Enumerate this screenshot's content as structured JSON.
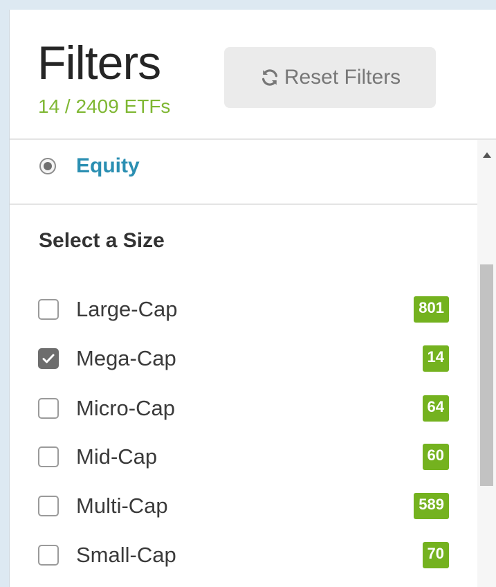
{
  "header": {
    "title": "Filters",
    "count_text": "14 / 2409 ETFs",
    "reset_label": "Reset Filters",
    "reset_icon": "refresh-icon"
  },
  "asset_type": {
    "label": "Equity",
    "selected": true
  },
  "size_filter": {
    "heading": "Select a Size",
    "items": [
      {
        "label": "Large-Cap",
        "count": "801",
        "checked": false
      },
      {
        "label": "Mega-Cap",
        "count": "14",
        "checked": true
      },
      {
        "label": "Micro-Cap",
        "count": "64",
        "checked": false
      },
      {
        "label": "Mid-Cap",
        "count": "60",
        "checked": false
      },
      {
        "label": "Multi-Cap",
        "count": "589",
        "checked": false
      },
      {
        "label": "Small-Cap",
        "count": "70",
        "checked": false
      }
    ]
  },
  "colors": {
    "accent_green": "#74b21f",
    "count_green": "#7fb733",
    "link_blue": "#2b8fb2"
  }
}
